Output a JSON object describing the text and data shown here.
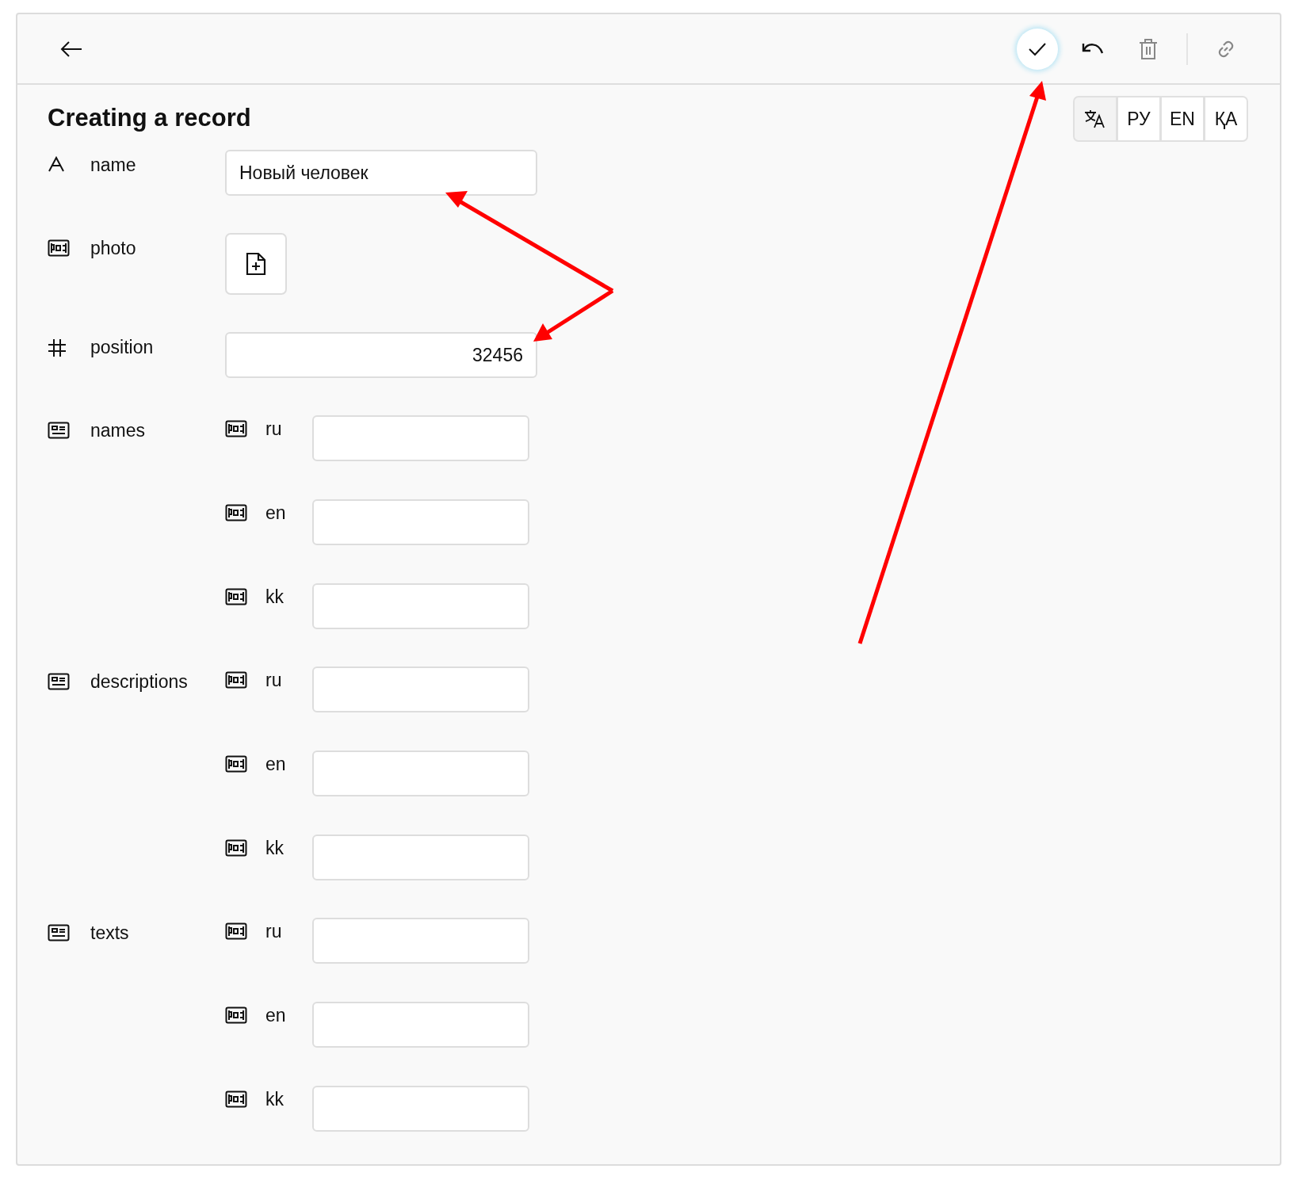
{
  "page": {
    "title": "Creating a record"
  },
  "language_switch": [
    {
      "kind": "auto",
      "selected": true
    },
    {
      "kind": "label",
      "label": "РУ",
      "selected": false
    },
    {
      "kind": "label",
      "label": "EN",
      "selected": false
    },
    {
      "kind": "label",
      "label": "ҚА",
      "selected": false
    }
  ],
  "fields": [
    {
      "kind": "text",
      "label": "name",
      "value": "Новый человек"
    },
    {
      "kind": "file",
      "label": "photo"
    },
    {
      "kind": "number",
      "label": "position",
      "value": "32456"
    },
    {
      "kind": "localized",
      "label": "names",
      "entries": [
        {
          "label": "ru"
        },
        {
          "label": "en"
        },
        {
          "label": "kk"
        }
      ]
    },
    {
      "kind": "localized",
      "label": "descriptions",
      "entries": [
        {
          "label": "ru"
        },
        {
          "label": "en"
        },
        {
          "label": "kk"
        }
      ]
    },
    {
      "kind": "localized",
      "label": "texts",
      "entries": [
        {
          "label": "ru"
        },
        {
          "label": "en"
        },
        {
          "label": "kk"
        }
      ]
    }
  ]
}
